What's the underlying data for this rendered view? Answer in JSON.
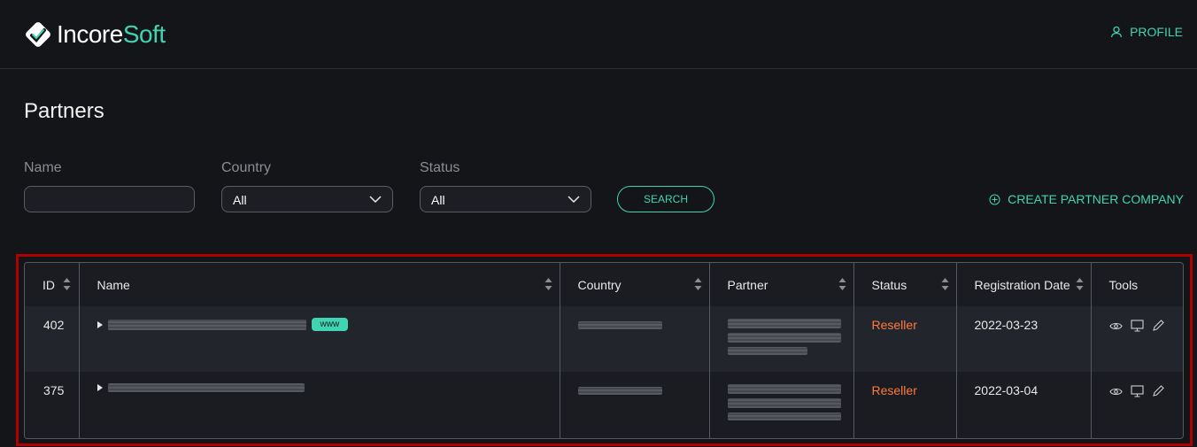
{
  "header": {
    "logo_text_part1": "Incore",
    "logo_text_part2": "Soft",
    "profile_label": "PROFILE"
  },
  "page": {
    "title": "Partners"
  },
  "filters": {
    "name_label": "Name",
    "name_value": "",
    "country_label": "Country",
    "country_value": "All",
    "status_label": "Status",
    "status_value": "All",
    "search_button": "SEARCH",
    "create_button": "CREATE PARTNER COMPANY"
  },
  "table": {
    "columns": [
      "ID",
      "Name",
      "Country",
      "Partner",
      "Status",
      "Registration Date",
      "Tools"
    ],
    "rows": [
      {
        "id": "402",
        "badge": "www",
        "status": "Reseller",
        "registration_date": "2022-03-23"
      },
      {
        "id": "375",
        "badge": "",
        "status": "Reseller",
        "registration_date": "2022-03-04"
      }
    ]
  },
  "colors": {
    "accent": "#3fd4b2",
    "status_reseller": "#ff7a3d",
    "highlight": "#b00000",
    "background": "#141519"
  },
  "icons": {
    "tools": [
      "eye-icon",
      "monitor-icon",
      "pencil-icon"
    ]
  }
}
